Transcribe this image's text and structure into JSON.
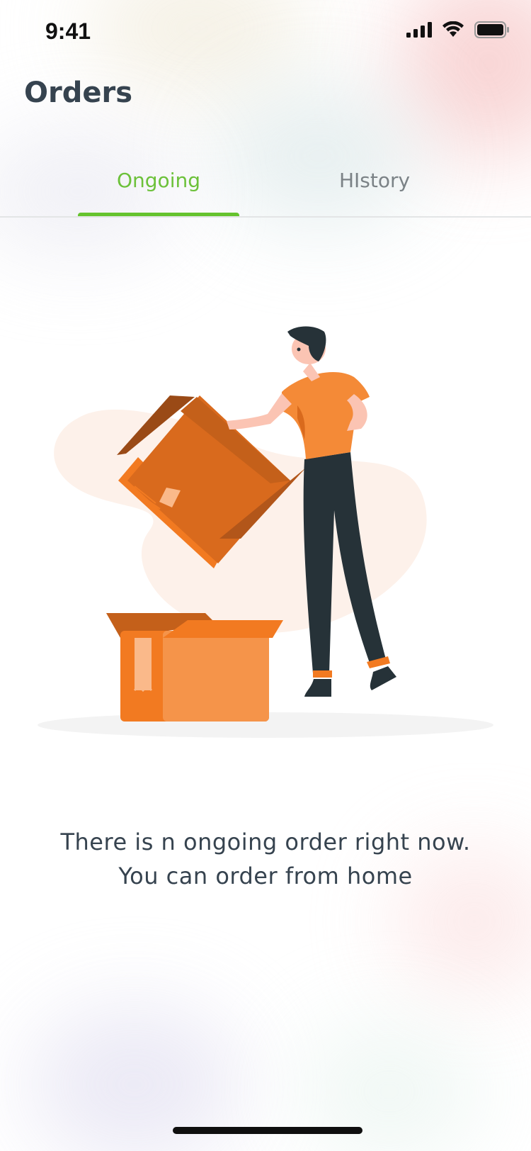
{
  "status_bar": {
    "time": "9:41",
    "icons": [
      "cellular-signal-icon",
      "wifi-icon",
      "battery-icon"
    ]
  },
  "header": {
    "title": "Orders"
  },
  "tabs": [
    {
      "label": "Ongoing",
      "active": true
    },
    {
      "label": "HIstory",
      "active": false
    }
  ],
  "empty_state": {
    "illustration": "person-unpacking-box-illustration",
    "message_line1": "There is n ongoing order right now.",
    "message_line2": "You can order from home"
  },
  "colors": {
    "accent": "#65c32e",
    "title": "#36434f",
    "inactive_tab": "#7b8286",
    "box_orange": "#f27a21"
  }
}
